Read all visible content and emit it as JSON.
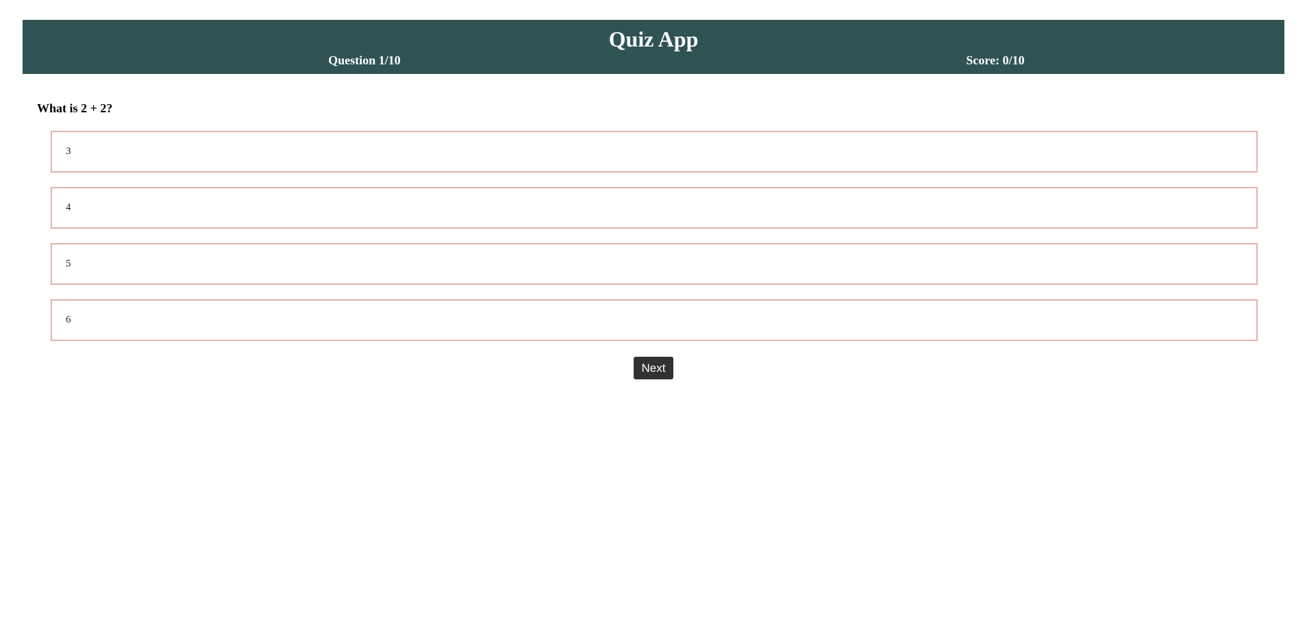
{
  "header": {
    "title": "Quiz App",
    "question_counter": "Question 1/10",
    "score": "Score: 0/10"
  },
  "question": {
    "text": "What is 2 + 2?",
    "options": [
      {
        "label": "3"
      },
      {
        "label": "4"
      },
      {
        "label": "5"
      },
      {
        "label": "6"
      }
    ]
  },
  "controls": {
    "next_label": "Next"
  },
  "colors": {
    "header_background": "#2f5352",
    "option_border": "#e3b3b3",
    "button_background": "#323230"
  }
}
